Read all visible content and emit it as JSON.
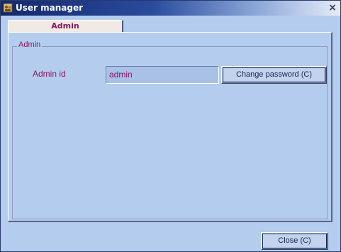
{
  "window": {
    "title": "User manager",
    "close_glyph": "×"
  },
  "tabs": [
    {
      "label": "Admin",
      "selected": true
    }
  ],
  "admin_group": {
    "label": "Admin",
    "admin_id_label": "Admin id",
    "admin_id_value": "admin",
    "change_password_label": "Change password (C)"
  },
  "footer": {
    "close_label": "Close (C)"
  },
  "icons": {
    "title_icon": "app-icon",
    "close_icon": "close-icon"
  },
  "colors": {
    "window_bg": "#b4cdee",
    "title_bar_start": "#14286e",
    "accent_text": "#8a1560",
    "tab_bg": "#f1e9e3"
  }
}
